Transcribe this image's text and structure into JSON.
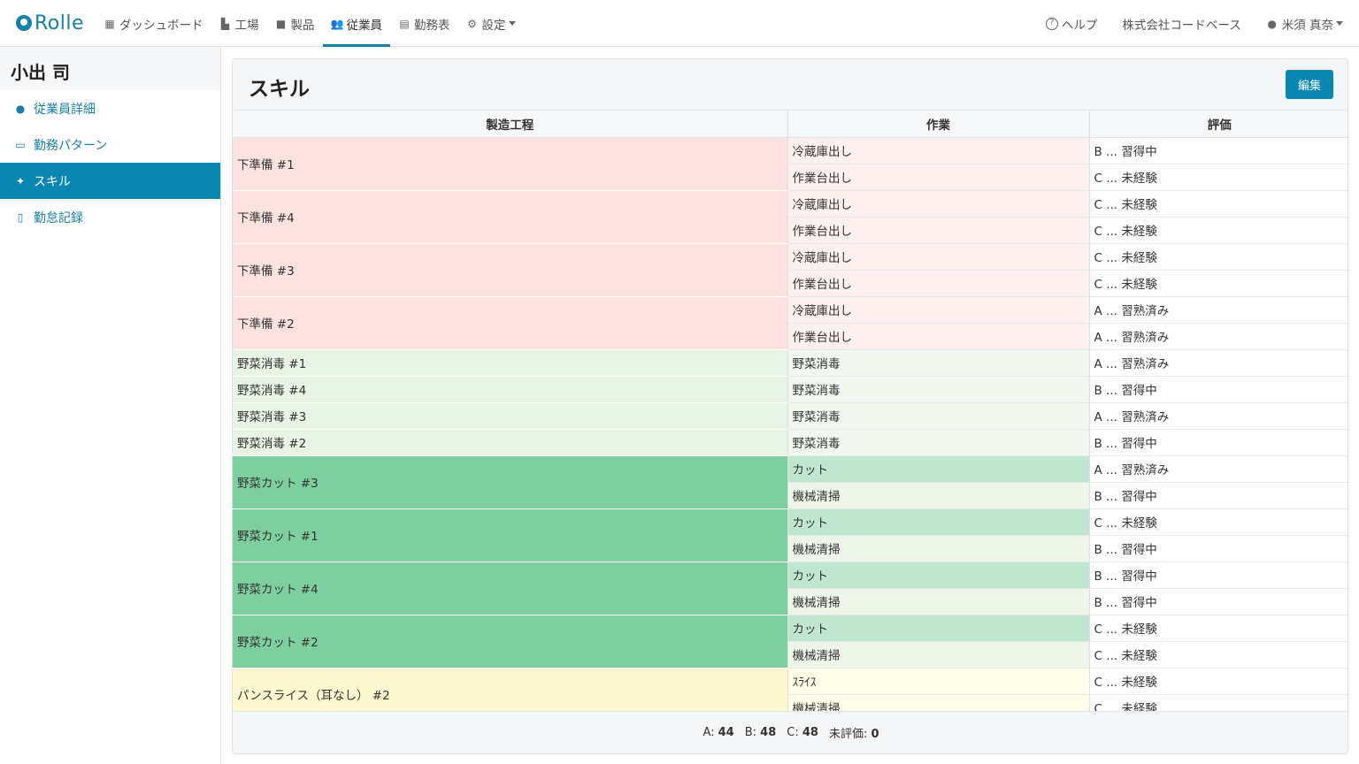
{
  "app": {
    "logo_text": "Rolle"
  },
  "nav": {
    "items": [
      {
        "label": "ダッシュボード",
        "icon": "calendar-icon",
        "glyph": "▦"
      },
      {
        "label": "工場",
        "icon": "factory-icon",
        "glyph": "▙"
      },
      {
        "label": "製品",
        "icon": "box-icon",
        "glyph": "■"
      },
      {
        "label": "従業員",
        "icon": "users-icon",
        "glyph": "👥"
      },
      {
        "label": "勤務表",
        "icon": "schedule-icon",
        "glyph": "▤"
      },
      {
        "label": "設定",
        "icon": "gear-icon",
        "glyph": "⚙"
      }
    ],
    "active_index": 3,
    "help": "ヘルプ",
    "company": "株式会社コードベース",
    "user": "米須 真奈"
  },
  "sidebar": {
    "title": "小出 司",
    "items": [
      {
        "label": "従業員詳細",
        "icon": "person-icon",
        "glyph": "●"
      },
      {
        "label": "勤務パターン",
        "icon": "calendar-icon",
        "glyph": "▭"
      },
      {
        "label": "スキル",
        "icon": "sparkle-icon",
        "glyph": "✦"
      },
      {
        "label": "勤怠記録",
        "icon": "clipboard-check-icon",
        "glyph": "▯"
      }
    ],
    "active_index": 2
  },
  "card": {
    "title": "スキル",
    "edit_label": "編集",
    "headers": [
      "製造工程",
      "作業",
      "評価"
    ]
  },
  "colors": {
    "prep_process": "#fde3e0",
    "prep_task": "#fdf0ef",
    "wash_process": "#e8f4e4",
    "wash_task": "#f2f8f0",
    "cut_process": "#7ecf9f",
    "cut_task_a": "#bfe6cf",
    "cut_task_b": "#edf6e8",
    "bread_process": "#fdf8cf",
    "bread_task": "#fefde9",
    "accent": "#0a87b0"
  },
  "groups": [
    {
      "process": "下準備 #1",
      "theme": "prep",
      "rows": [
        {
          "task": "冷蔵庫出し",
          "rating": "B ... 習得中"
        },
        {
          "task": "作業台出し",
          "rating": "C ... 未経験"
        }
      ]
    },
    {
      "process": "下準備 #4",
      "theme": "prep",
      "rows": [
        {
          "task": "冷蔵庫出し",
          "rating": "C ... 未経験"
        },
        {
          "task": "作業台出し",
          "rating": "C ... 未経験"
        }
      ]
    },
    {
      "process": "下準備 #3",
      "theme": "prep",
      "rows": [
        {
          "task": "冷蔵庫出し",
          "rating": "C ... 未経験"
        },
        {
          "task": "作業台出し",
          "rating": "C ... 未経験"
        }
      ]
    },
    {
      "process": "下準備 #2",
      "theme": "prep",
      "rows": [
        {
          "task": "冷蔵庫出し",
          "rating": "A ... 習熟済み"
        },
        {
          "task": "作業台出し",
          "rating": "A ... 習熟済み"
        }
      ]
    },
    {
      "process": "野菜消毒 #1",
      "theme": "wash",
      "rows": [
        {
          "task": "野菜消毒",
          "rating": "A ... 習熟済み"
        }
      ]
    },
    {
      "process": "野菜消毒 #4",
      "theme": "wash",
      "rows": [
        {
          "task": "野菜消毒",
          "rating": "B ... 習得中"
        }
      ]
    },
    {
      "process": "野菜消毒 #3",
      "theme": "wash",
      "rows": [
        {
          "task": "野菜消毒",
          "rating": "A ... 習熟済み"
        }
      ]
    },
    {
      "process": "野菜消毒 #2",
      "theme": "wash",
      "rows": [
        {
          "task": "野菜消毒",
          "rating": "B ... 習得中"
        }
      ]
    },
    {
      "process": "野菜カット #3",
      "theme": "cut",
      "rows": [
        {
          "task": "カット",
          "rating": "A ... 習熟済み"
        },
        {
          "task": "機械清掃",
          "rating": "B ... 習得中"
        }
      ]
    },
    {
      "process": "野菜カット #1",
      "theme": "cut",
      "rows": [
        {
          "task": "カット",
          "rating": "C ... 未経験"
        },
        {
          "task": "機械清掃",
          "rating": "B ... 習得中"
        }
      ]
    },
    {
      "process": "野菜カット #4",
      "theme": "cut",
      "rows": [
        {
          "task": "カット",
          "rating": "B ... 習得中"
        },
        {
          "task": "機械清掃",
          "rating": "B ... 習得中"
        }
      ]
    },
    {
      "process": "野菜カット #2",
      "theme": "cut",
      "rows": [
        {
          "task": "カット",
          "rating": "C ... 未経験"
        },
        {
          "task": "機械清掃",
          "rating": "C ... 未経験"
        }
      ]
    },
    {
      "process": "パンスライス（耳なし） #2",
      "theme": "bread",
      "rows": [
        {
          "task": "ｽﾗｲｽ",
          "rating": "C ... 未経験"
        },
        {
          "task": "機械清掃",
          "rating": "C ... 未経験"
        }
      ]
    }
  ],
  "summary": [
    {
      "label": "A:",
      "value": "44"
    },
    {
      "label": "B:",
      "value": "48"
    },
    {
      "label": "C:",
      "value": "48"
    },
    {
      "label": "未評価:",
      "value": "0"
    }
  ]
}
